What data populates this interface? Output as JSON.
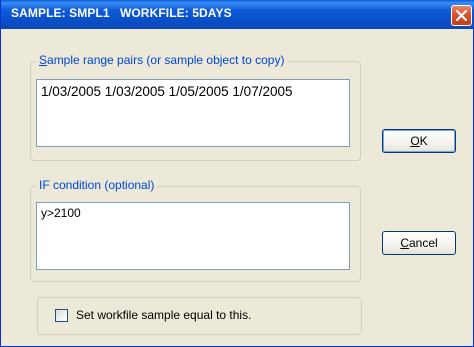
{
  "window": {
    "title": "SAMPLE: SMPL1   WORKFILE: 5DAYS"
  },
  "sample_range": {
    "label_accel": "S",
    "label_rest": "ample range pairs (or sample object to copy)",
    "value": "1/03/2005 1/03/2005 1/05/2005 1/07/2005"
  },
  "if_condition": {
    "label": "IF condition (optional)",
    "value": "y>2100"
  },
  "buttons": {
    "ok_accel": "O",
    "ok_rest": "K",
    "cancel_accel": "C",
    "cancel_rest": "ancel"
  },
  "checkbox": {
    "label": "Set workfile sample equal to this.",
    "checked": false
  },
  "icons": {
    "close": "close-x-icon"
  }
}
